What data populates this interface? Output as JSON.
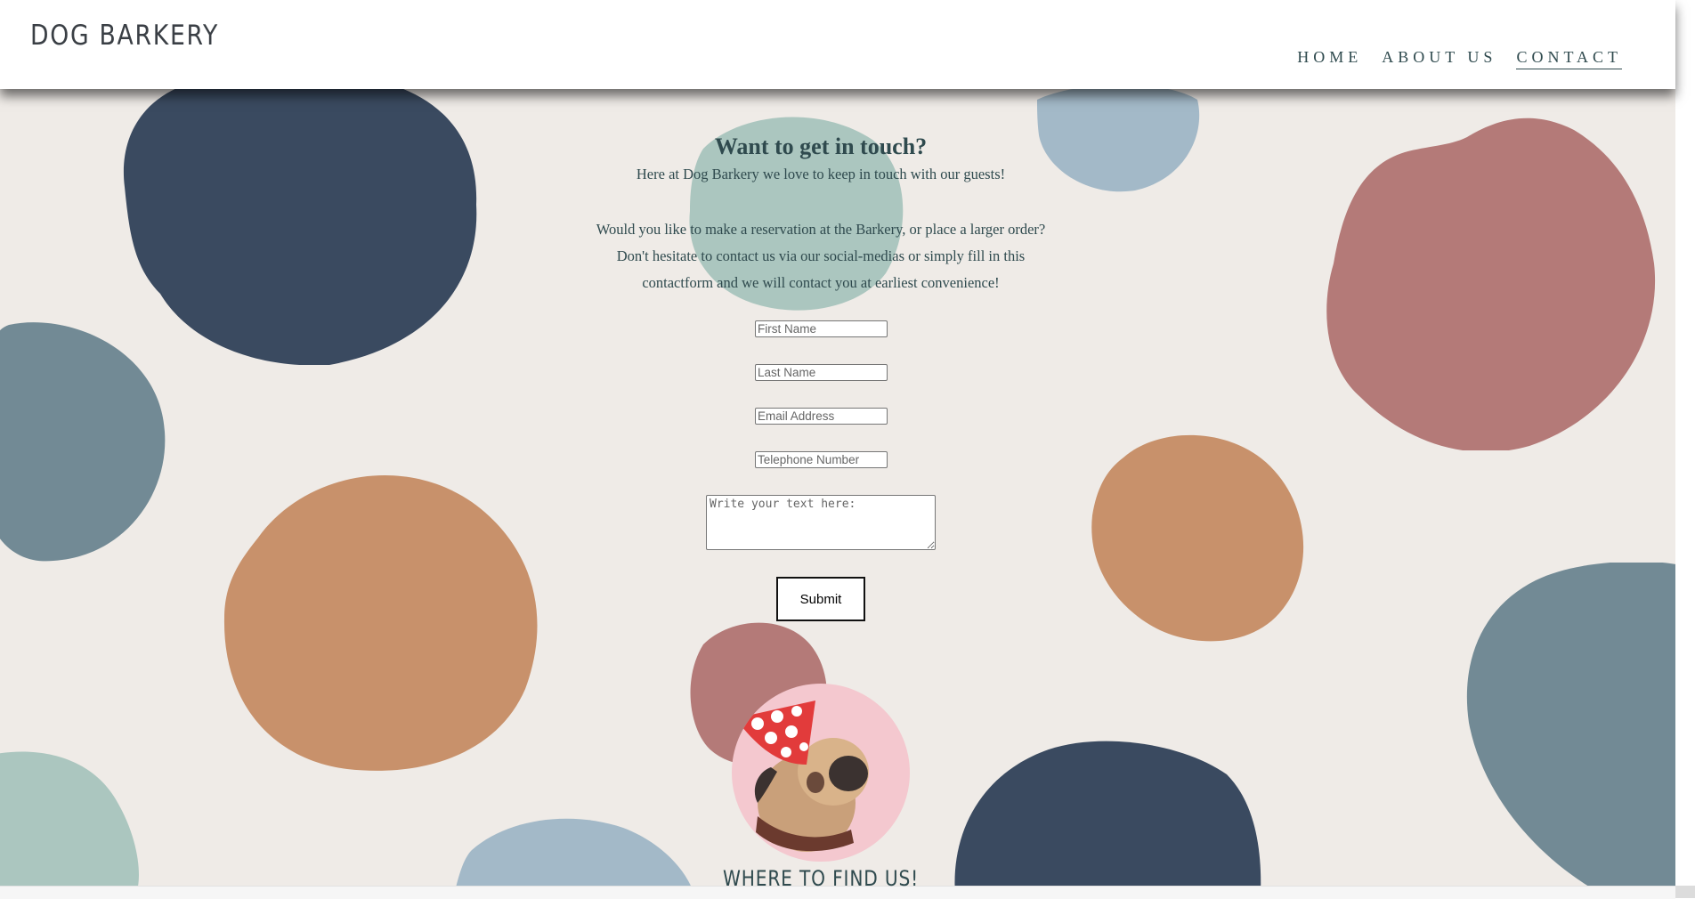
{
  "header": {
    "logo": "DOG BARKERY",
    "nav": [
      {
        "label": "HOME"
      },
      {
        "label": "ABOUT US"
      },
      {
        "label": "CONTACT"
      }
    ],
    "active": "CONTACT"
  },
  "main": {
    "heading": "Want to get in touch?",
    "intro": "Here at Dog Barkery we love to keep in touch with our guests!",
    "paragraph": "Would you like to make a reservation at the Barkery, or place a larger order? Don't hesitate to contact us via our social-medias or simply fill in this contactform and we will contact you at earliest convenience!",
    "form": {
      "first_name_placeholder": "First Name",
      "last_name_placeholder": "Last Name",
      "email_placeholder": "Email Address",
      "phone_placeholder": "Telephone Number",
      "message_placeholder": "Write your text here:",
      "submit_label": "Submit"
    },
    "photo_icon": "pug-party-hat-photo",
    "footer_heading": "WHERE TO FIND US!"
  },
  "colors": {
    "navy": "#3a4a60",
    "slate": "#728a95",
    "sage": "#abc6bf",
    "powder_blue": "#a3b9c8",
    "dusty_rose": "#b47a78",
    "terracotta": "#c8916b",
    "background": "#efebe7",
    "text": "#2f4a4e"
  }
}
